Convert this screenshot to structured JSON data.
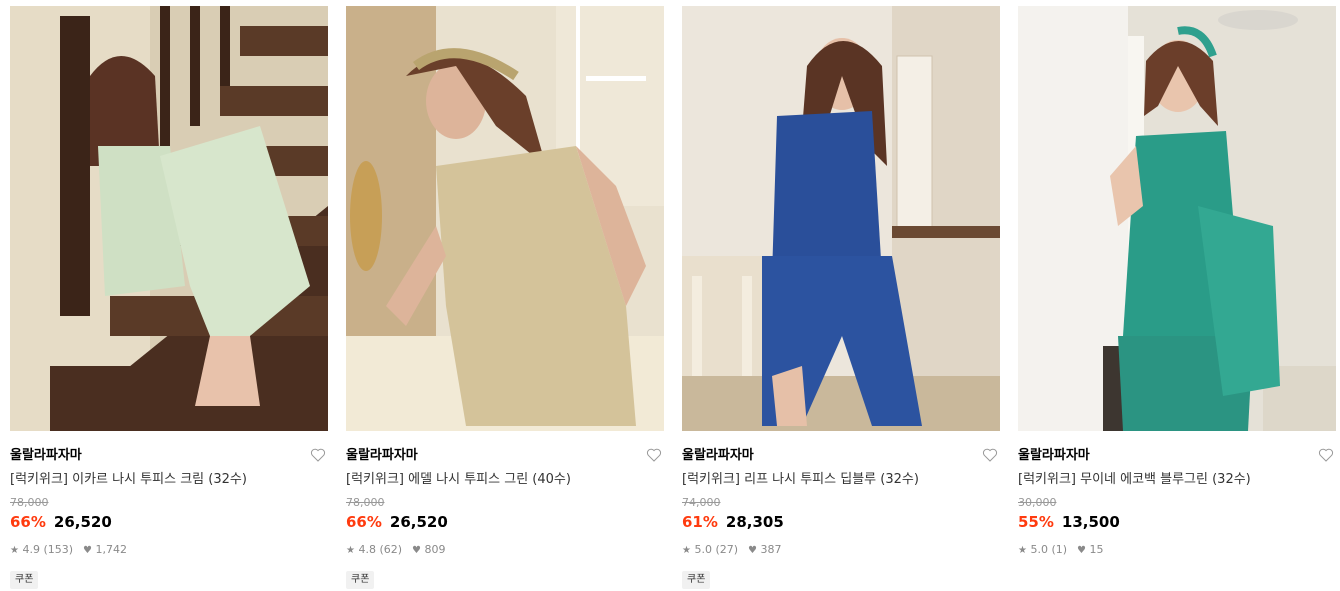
{
  "products": [
    {
      "brand": "울랄라파자마",
      "title": "[럭키위크] 이카르 나시 투피스 크림 (32수)",
      "original_price": "78,000",
      "discount": "66%",
      "price": "26,520",
      "rating": "4.9 (153)",
      "likes": "1,742",
      "badge": "쿠폰",
      "image": "woman-on-stairs-in-cream-striped-pajamas"
    },
    {
      "brand": "울랄라파자마",
      "title": "[럭키위크] 에델 나시 투피스 그린 (40수)",
      "original_price": "78,000",
      "discount": "66%",
      "price": "26,520",
      "rating": "4.8 (62)",
      "likes": "809",
      "badge": "쿠폰",
      "image": "woman-in-floral-green-camisole-set"
    },
    {
      "brand": "울랄라파자마",
      "title": "[럭키위크] 리프 나시 투피스 딥블루 (32수)",
      "original_price": "74,000",
      "discount": "61%",
      "price": "28,305",
      "rating": "5.0 (27)",
      "likes": "387",
      "badge": "쿠폰",
      "image": "woman-in-blue-leaf-print-pajamas"
    },
    {
      "brand": "울랄라파자마",
      "title": "[럭키위크] 무이네 에코백 블루그린 (32수)",
      "original_price": "30,000",
      "discount": "55%",
      "price": "13,500",
      "rating": "5.0 (1)",
      "likes": "15",
      "badge": "",
      "image": "woman-with-teal-eco-bag"
    }
  ],
  "colors": {
    "discount": "#ff3b0f",
    "muted": "#999999"
  },
  "icons": {
    "wishlist": "heart-outline-icon",
    "rating": "star-icon",
    "likes": "heart-filled-icon"
  }
}
